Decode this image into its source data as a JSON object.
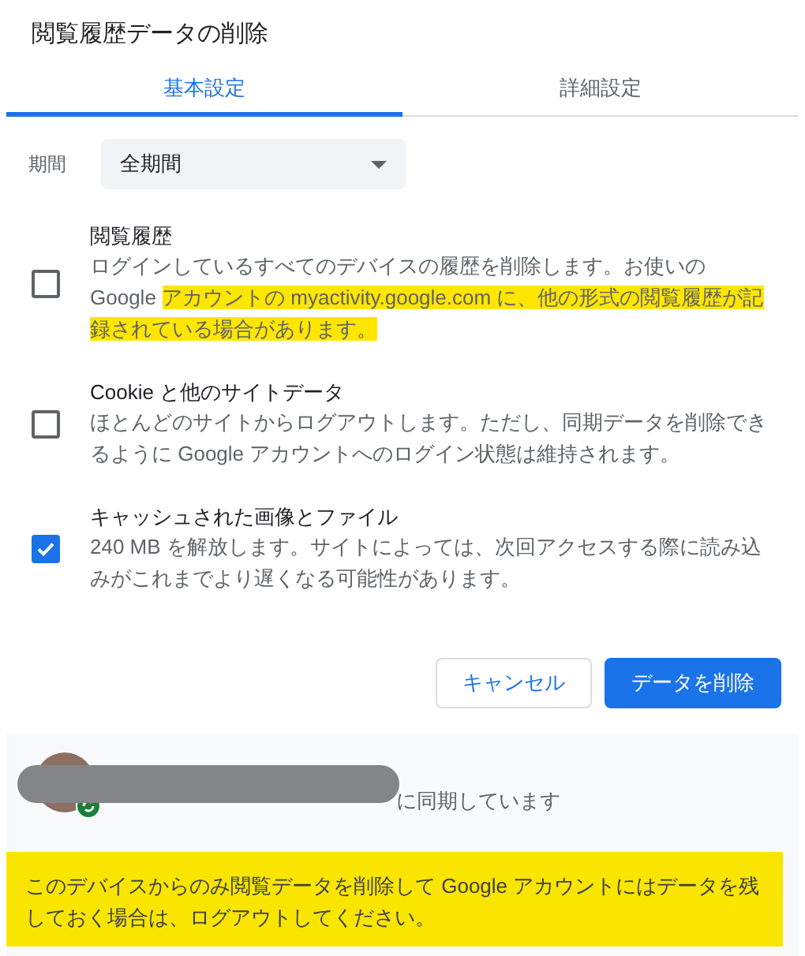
{
  "dialog": {
    "title": "閲覧履歴データの削除"
  },
  "tabs": [
    {
      "label": "基本設定",
      "selected": true
    },
    {
      "label": "詳細設定",
      "selected": false
    }
  ],
  "period": {
    "label": "期間",
    "value": "全期間"
  },
  "items": [
    {
      "title": "閲覧履歴",
      "checked": false,
      "description": [
        {
          "text": "ログインしているすべてのデバイスの履歴を削除します。お使いの Google ",
          "highlighted": false
        },
        {
          "text": "アカウントの myactivity.google.com に、他の形式の閲覧履歴が記録されている場合があります。",
          "highlighted": true
        }
      ]
    },
    {
      "title": "Cookie と他のサイトデータ",
      "checked": false,
      "description": [
        {
          "text": "ほとんどのサイトからログアウトします。ただし、同期データを削除できるように Google アカウントへのログイン状態は維持されます。",
          "highlighted": false
        }
      ]
    },
    {
      "title": "キャッシュされた画像とファイル",
      "checked": true,
      "description": [
        {
          "text": "240 MB を解放します。サイトによっては、次回アクセスする際に読み込みがこれまでより遅くなる可能性があります。",
          "highlighted": false
        }
      ]
    }
  ],
  "buttons": [
    {
      "label": "キャンセル",
      "kind": "secondary"
    },
    {
      "label": "データを削除",
      "kind": "primary"
    }
  ],
  "account": {
    "sync_text": "に同期しています"
  },
  "notice": {
    "text": "このデバイスからのみ閲覧データを削除して Google アカウントにはデータを残しておく場合は、ログアウトしてください。",
    "highlighted": true
  }
}
